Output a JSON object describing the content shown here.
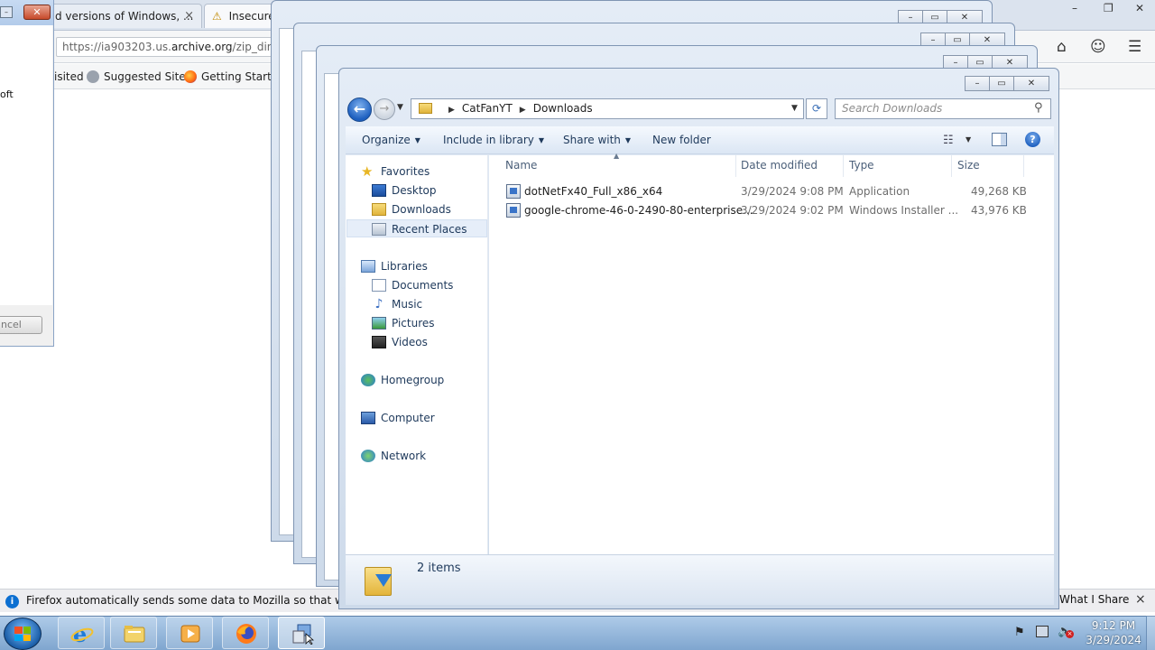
{
  "firefox": {
    "tabs": [
      {
        "label": "d versions of Windows, ...",
        "close": "×"
      },
      {
        "label": "Insecure",
        "warn": "⚠"
      }
    ],
    "url_prefix": "https://ia903203.us.",
    "url_domain": "archive.org",
    "url_path": "/zip_dir.php?",
    "bookmarks": [
      "isited",
      "Suggested Sites",
      "Getting Started"
    ],
    "notification": "Firefox automatically sends some data to Mozilla so that we can im",
    "notification_action": "What I Share",
    "notification_close": "×",
    "window_controls": {
      "min": "–",
      "max": "❐",
      "close": "✕"
    }
  },
  "dialog": {
    "text": "oft",
    "cancel": "ncel",
    "close": "✕",
    "min": "–"
  },
  "explorer": {
    "caption": {
      "min": "–",
      "max": "▭",
      "close": "✕"
    },
    "breadcrumb": [
      "CatFanYT",
      "Downloads"
    ],
    "search_placeholder": "Search Downloads",
    "toolbar": {
      "organize": "Organize",
      "include": "Include in library",
      "share": "Share with",
      "new_folder": "New folder"
    },
    "nav": {
      "favorites": "Favorites",
      "desktop": "Desktop",
      "downloads": "Downloads",
      "recent": "Recent Places",
      "libraries": "Libraries",
      "documents": "Documents",
      "music": "Music",
      "pictures": "Pictures",
      "videos": "Videos",
      "homegroup": "Homegroup",
      "computer": "Computer",
      "network": "Network"
    },
    "columns": {
      "name": "Name",
      "date": "Date modified",
      "type": "Type",
      "size": "Size"
    },
    "files": [
      {
        "name": "dotNetFx40_Full_x86_x64",
        "date": "3/29/2024 9:08 PM",
        "type": "Application",
        "size": "49,268 KB"
      },
      {
        "name": "google-chrome-46-0-2490-80-enterprise...",
        "date": "3/29/2024 9:02 PM",
        "type": "Windows Installer ...",
        "size": "43,976 KB"
      }
    ],
    "item_count": "2 items"
  },
  "taskbar": {
    "time": "9:12 PM",
    "date": "3/29/2024"
  },
  "colors": {
    "accent": "#1d5fbf",
    "text": "#1e395b",
    "taskbar": "#7fa6cf"
  }
}
